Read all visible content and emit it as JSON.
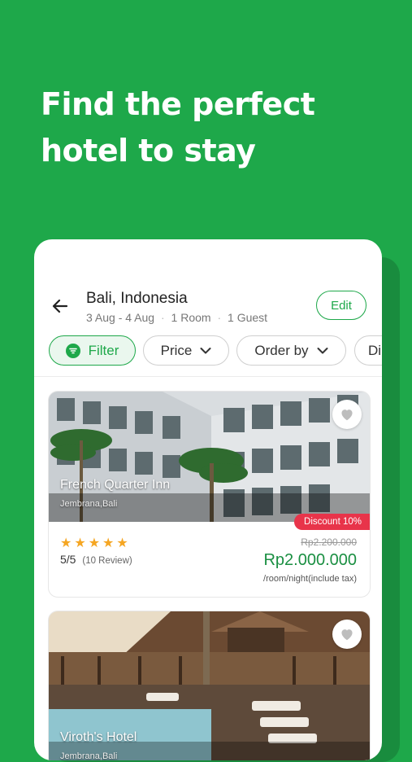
{
  "headline": {
    "line1": "Find the perfect",
    "line2": "hotel to stay"
  },
  "search": {
    "location": "Bali, Indonesia",
    "dates": "3 Aug - 4 Aug",
    "rooms": "1 Room",
    "guests": "1 Guest",
    "separator": "·",
    "edit_label": "Edit"
  },
  "chips": [
    {
      "label": "Filter"
    },
    {
      "label": "Price"
    },
    {
      "label": "Order by"
    },
    {
      "label": "Di"
    }
  ],
  "hotels": [
    {
      "name": "French Quarter Inn",
      "location": "Jembrana,Bali",
      "discount": "Discount 10%",
      "stars": "★★★★★",
      "rating": "5/5",
      "reviews": "(10 Review)",
      "old_price": "Rp2.200.000",
      "price": "Rp2.000.000",
      "price_unit": "/room/night(include tax)"
    },
    {
      "name": "Viroth's Hotel",
      "location": "Jembrana,Bali"
    }
  ],
  "colors": {
    "brand": "#1ea84a",
    "discount": "#e8344a",
    "star": "#f5a623",
    "price": "#1a8f42"
  }
}
